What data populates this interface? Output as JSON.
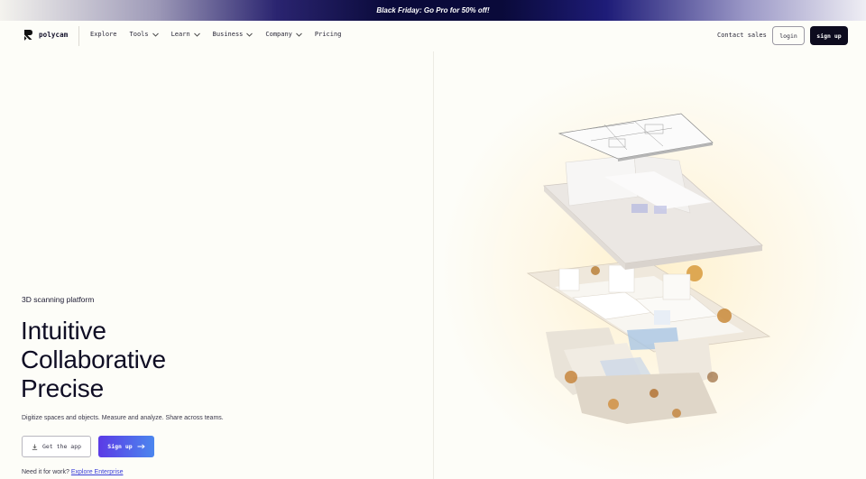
{
  "promo": {
    "text": "Black Friday: Go Pro for 50% off!"
  },
  "nav": {
    "logo_text": "polycam",
    "links": [
      {
        "label": "Explore",
        "dropdown": false
      },
      {
        "label": "Tools",
        "dropdown": true
      },
      {
        "label": "Learn",
        "dropdown": true
      },
      {
        "label": "Business",
        "dropdown": true
      },
      {
        "label": "Company",
        "dropdown": true
      },
      {
        "label": "Pricing",
        "dropdown": false
      }
    ],
    "contact_label": "Contact sales",
    "login_label": "login",
    "signup_label": "sign up"
  },
  "hero": {
    "eyebrow": "3D scanning platform",
    "headline": [
      "Intuitive",
      "Collaborative",
      "Precise"
    ],
    "subtitle": "Digitize spaces and objects. Measure and analyze. Share across teams.",
    "get_app_label": "Get the app",
    "signup_label": "Sign up",
    "work_prompt": "Need it for work?",
    "enterprise_link": "Explore Enterprise"
  },
  "colors": {
    "accent": "#5b3be6",
    "dark_button": "#0d0b1e",
    "background": "#fdfdf8",
    "link": "#3b3fd8"
  },
  "icons": {
    "logo": "polycam-logo-icon",
    "chevron": "chevron-down-icon",
    "download": "download-icon",
    "arrow": "arrow-right-icon"
  },
  "illustration": {
    "name": "3d-floor-plan-scan"
  }
}
